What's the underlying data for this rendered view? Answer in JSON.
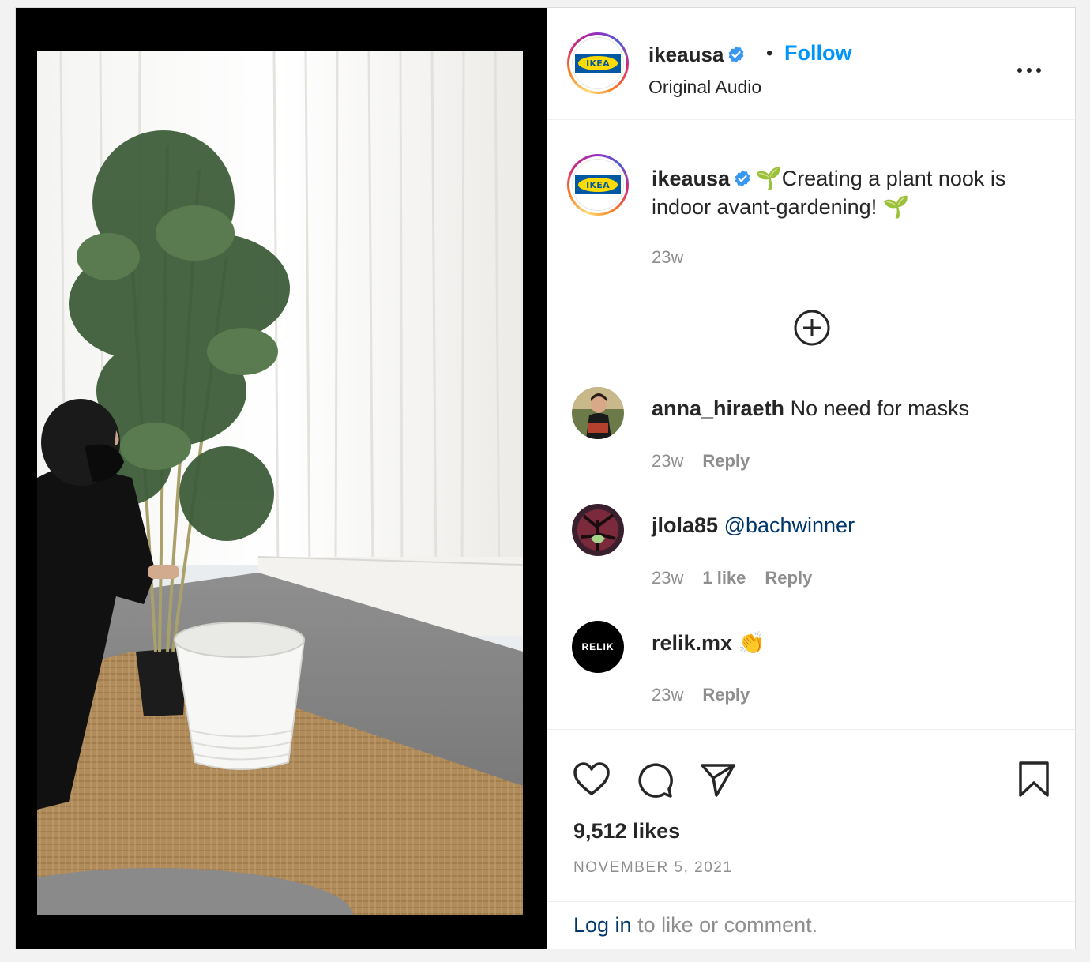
{
  "header": {
    "username": "ikeausa",
    "separator": "•",
    "follow_label": "Follow",
    "subtitle": "Original Audio",
    "avatar_text": "IKEA"
  },
  "caption": {
    "username": "ikeausa",
    "text": "🌱Creating a plant nook is indoor avant-gardening! 🌱",
    "time": "23w"
  },
  "comments": [
    {
      "username": "anna_hiraeth",
      "text": "No need for masks",
      "time": "23w",
      "likes": "",
      "reply_label": "Reply"
    },
    {
      "username": "jlola85",
      "text": "@bachwinner",
      "time": "23w",
      "likes": "1 like",
      "reply_label": "Reply"
    },
    {
      "username": "relik.mx",
      "text": "👏",
      "time": "23w",
      "likes": "",
      "reply_label": "Reply",
      "avatar_text": "RELIK"
    }
  ],
  "stats": {
    "likes": "9,512 likes",
    "date": "NOVEMBER 5, 2021"
  },
  "footer": {
    "login_link": "Log in",
    "login_rest": " to like or comment."
  },
  "colors": {
    "follow": "#0095f6",
    "verified": "#3897f0",
    "mention": "#00376b",
    "muted": "#8e8e8e",
    "ikea_blue": "#0058a3",
    "ikea_yellow": "#ffdb00"
  },
  "icons": [
    "verified-badge-icon",
    "more-options-icon",
    "load-more-comments-icon",
    "heart-icon",
    "comment-icon",
    "share-icon",
    "bookmark-icon"
  ]
}
